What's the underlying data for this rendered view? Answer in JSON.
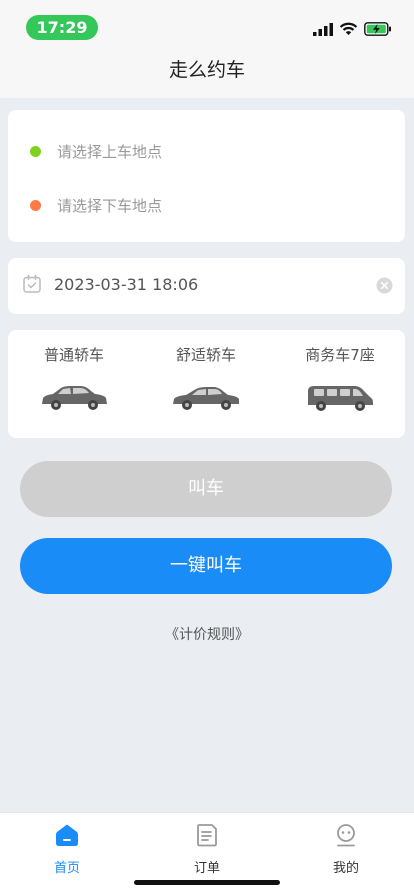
{
  "status": {
    "time": "17:29"
  },
  "nav": {
    "title": "走么约车"
  },
  "locations": {
    "pickup_placeholder": "请选择上车地点",
    "dropoff_placeholder": "请选择下车地点",
    "pickup_color": "#7ed321",
    "dropoff_color": "#ff7a45"
  },
  "datetime": {
    "value": "2023-03-31 18:06"
  },
  "cars": [
    {
      "label": "普通轿车",
      "icon": "sedan-icon"
    },
    {
      "label": "舒适轿车",
      "icon": "comfort-sedan-icon"
    },
    {
      "label": "商务车7座",
      "icon": "van-icon"
    }
  ],
  "buttons": {
    "call": "叫车",
    "one_click": "一键叫车"
  },
  "rules": {
    "label": "《计价规则》"
  },
  "tabs": [
    {
      "label": "首页",
      "icon": "home-icon",
      "active": true
    },
    {
      "label": "订单",
      "icon": "order-icon",
      "active": false
    },
    {
      "label": "我的",
      "icon": "profile-icon",
      "active": false
    }
  ],
  "colors": {
    "accent": "#1a8cf7",
    "disabled": "#cfcfcf",
    "status_green": "#34c759"
  }
}
